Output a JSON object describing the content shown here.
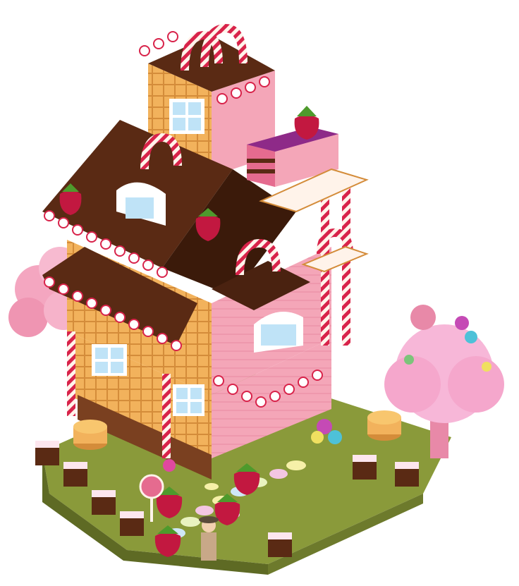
{
  "scene": {
    "name": "candy-gingerbread-house",
    "palette": {
      "background": "#ffffff",
      "chocolate": "#5a2a14",
      "chocolate_dark": "#3b1a0a",
      "wafer": "#f2b25c",
      "wafer_dark": "#d48c3a",
      "pink_wall": "#f4a6b8",
      "pink_dark": "#d9607e",
      "cream": "#fff3ea",
      "candy_red": "#d8234a",
      "berry": "#c21840",
      "leaf": "#4e9a2c",
      "grass": "#8a9a3a",
      "window_blue": "#bfe3f7",
      "cotton_candy": "#f7b7d8",
      "cake_top": "#8e2a88",
      "cake_layer": "#e56b8f"
    }
  }
}
